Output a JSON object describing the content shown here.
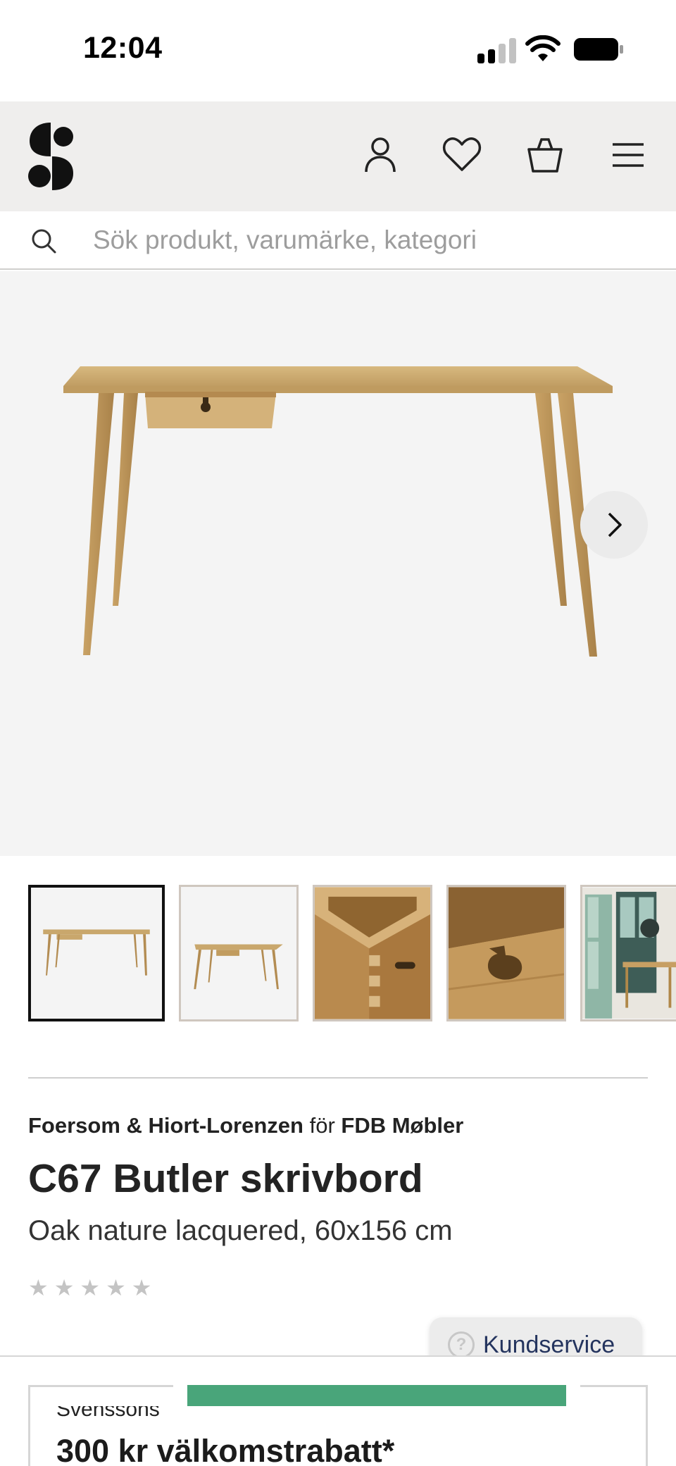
{
  "status_bar": {
    "time": "12:04",
    "signal_bars": 4,
    "signal_active": 2,
    "wifi": "wifi-icon",
    "battery": "battery-icon"
  },
  "header": {
    "logo": "S",
    "icons": [
      "account-icon",
      "heart-icon",
      "basket-icon",
      "menu-icon"
    ]
  },
  "search": {
    "placeholder": "Sök produkt, varumärke, kategori",
    "icon": "search-icon"
  },
  "gallery": {
    "next_icon": "chevron-right-icon",
    "thumbnail_count": 5,
    "active_index": 0
  },
  "product": {
    "designer": "Foersom & Hiort-Lorenzen",
    "for_word": "för",
    "brand": "FDB Møbler",
    "title": "C67 Butler skrivbord",
    "variant": "Oak nature lacquered, 60x156 cm",
    "rating_stars": 5,
    "rating_value": 0
  },
  "service": {
    "label": "Kundservice",
    "icon": "question-icon"
  },
  "promo": {
    "eyebrow": "Svenssons",
    "title": "300 kr välkomstrabatt*"
  },
  "colors": {
    "header_bg": "#efeeed",
    "accent_green": "#49a57a",
    "service_text": "#24345e",
    "hero_bg": "#f4f4f4"
  }
}
